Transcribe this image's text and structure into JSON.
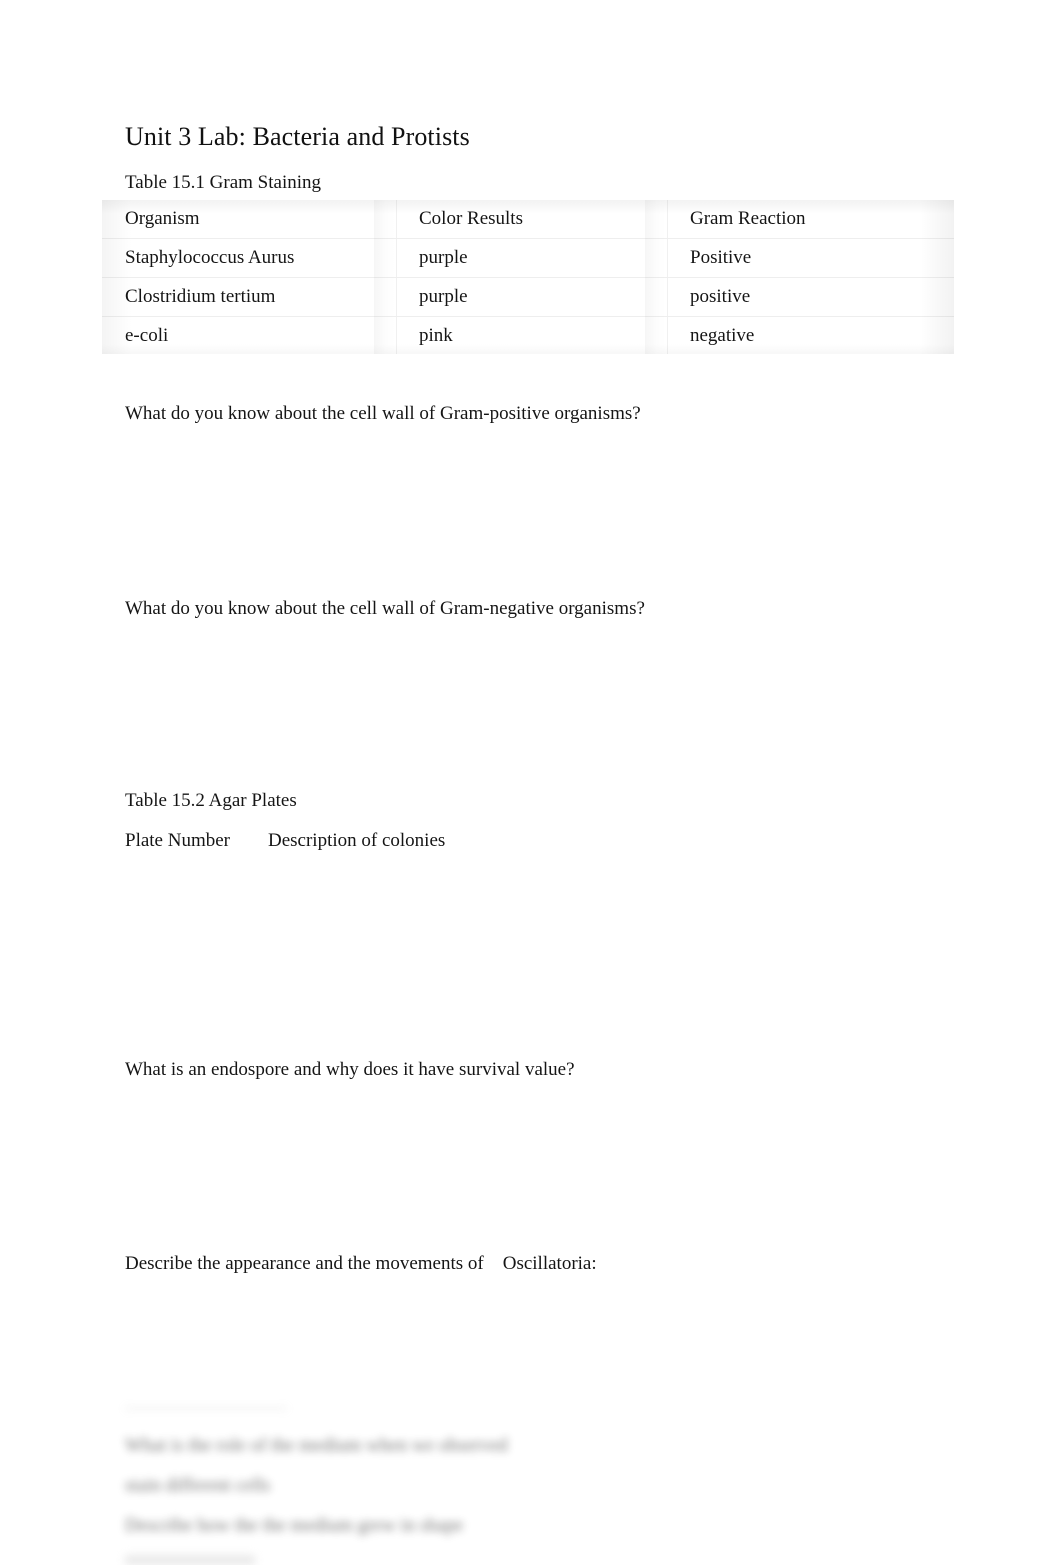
{
  "document": {
    "title": "Unit 3 Lab: Bacteria and Protists",
    "background_color": "#ffffff",
    "text_color": "#151515"
  },
  "table_15_1": {
    "caption": "Table 15.1 Gram Staining",
    "columns": [
      "Organism",
      "Color Results",
      "Gram Reaction"
    ],
    "rows": [
      {
        "organism": "Staphylococcus Aurus",
        "color": "purple",
        "reaction": "Positive"
      },
      {
        "organism": "Clostridium tertium",
        "color": "purple",
        "reaction": "positive"
      },
      {
        "organism": "e-coli",
        "color": "pink",
        "reaction": "negative"
      }
    ]
  },
  "questions": {
    "q1": "What do you know about the cell wall of Gram-positive organisms?",
    "q2": "What do you know about the cell wall of Gram-negative organisms?",
    "q3": "What is an endospore and why does it have survival value?",
    "q4": "Describe the appearance and the movements of    Oscillatoria:"
  },
  "table_15_2": {
    "caption": "Table 15.2 Agar Plates",
    "headers_line": "Plate Number        Description of colonies"
  },
  "obscured_footer": {
    "note": "blurred preview text",
    "lines": [
      "What is the role of the medium when we observed",
      "stain different cells",
      "Describe how the the medium grew in shape"
    ]
  }
}
